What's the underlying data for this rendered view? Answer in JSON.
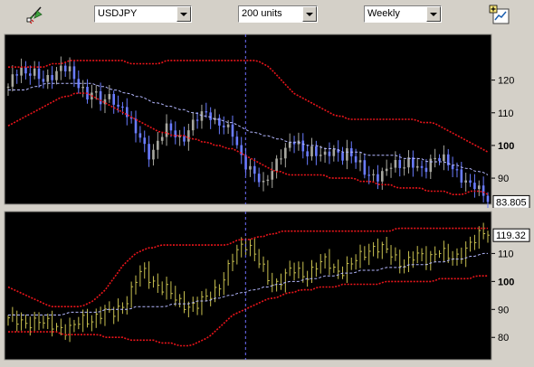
{
  "toolbar": {
    "symbol": "USDJPY",
    "units": "200 units",
    "period": "Weekly",
    "icons": [
      "drawing-tools-icon",
      "chart-settings-icon"
    ]
  },
  "colors": {
    "chart_bg": "#000000",
    "band": "#e8141a",
    "ma": "#b4b8ff",
    "candle_up": "#a8a8a0",
    "candle_down": "#6a7cff",
    "osc": "#c8c050",
    "grid_border": "#9c9a94",
    "cursor": "#7070ff"
  },
  "chart_data": [
    {
      "type": "candlestick",
      "ylim": [
        82,
        134
      ],
      "yticks": [
        90,
        100,
        110,
        120
      ],
      "last_value": "83.805",
      "price_points": [
        118,
        121,
        123,
        122,
        124,
        121,
        119,
        120,
        123,
        125,
        124,
        119,
        117,
        115,
        118,
        114,
        113,
        115,
        111,
        113,
        108,
        104,
        101,
        97,
        99,
        103,
        105,
        104,
        102,
        103,
        106,
        108,
        109,
        110,
        108,
        107,
        105,
        103,
        98,
        95,
        93,
        90,
        87,
        91,
        95,
        98,
        99,
        101,
        100,
        98,
        99,
        97,
        96,
        98,
        99,
        97,
        98,
        95,
        94,
        92,
        91,
        90,
        91,
        94,
        95,
        94,
        95,
        93,
        92,
        94,
        97,
        96,
        95,
        93,
        92,
        90,
        88,
        87,
        85,
        84
      ],
      "band_upper": [
        124,
        124,
        124,
        124,
        124,
        124,
        124,
        125,
        125,
        125,
        126,
        126,
        126,
        126,
        126,
        126,
        126,
        126,
        126,
        126,
        125,
        125,
        125,
        125,
        125,
        125,
        126,
        126,
        126,
        126,
        126,
        126,
        126,
        126,
        126,
        126,
        126,
        126,
        126,
        126,
        126,
        126,
        125,
        124,
        122,
        120,
        118,
        116,
        115,
        114,
        113,
        112,
        111,
        110,
        109,
        109,
        108,
        108,
        108,
        108,
        108,
        108,
        108,
        108,
        108,
        108,
        108,
        108,
        107,
        107,
        107,
        106,
        105,
        104,
        103,
        102,
        101,
        100,
        99,
        98
      ],
      "band_lower": [
        106,
        107,
        108,
        109,
        110,
        111,
        112,
        113,
        114,
        115,
        115,
        116,
        116,
        116,
        115,
        114,
        113,
        112,
        111,
        110,
        109,
        108,
        107,
        106,
        105,
        104,
        104,
        103,
        103,
        103,
        102,
        102,
        101,
        101,
        100,
        100,
        99,
        99,
        98,
        97,
        96,
        95,
        94,
        93,
        92,
        92,
        91,
        91,
        91,
        91,
        91,
        91,
        91,
        90,
        90,
        90,
        90,
        90,
        89,
        89,
        89,
        88,
        88,
        88,
        87,
        87,
        87,
        87,
        87,
        86,
        86,
        86,
        86,
        85,
        85,
        85,
        86,
        86,
        86,
        85
      ],
      "ma_line": [
        117,
        117,
        117,
        117,
        118,
        118,
        119,
        119,
        119,
        119,
        119,
        119,
        119,
        119,
        119,
        118,
        118,
        117,
        117,
        116,
        116,
        115,
        115,
        114,
        113,
        113,
        112,
        112,
        111,
        111,
        110,
        110,
        109,
        109,
        108,
        108,
        107,
        107,
        106,
        105,
        104,
        104,
        103,
        103,
        102,
        102,
        101,
        101,
        101,
        100,
        100,
        100,
        99,
        99,
        99,
        98,
        98,
        98,
        98,
        97,
        97,
        97,
        97,
        97,
        97,
        96,
        96,
        96,
        96,
        95,
        95,
        95,
        95,
        94,
        94,
        93,
        93,
        92,
        92,
        91
      ]
    },
    {
      "type": "bar",
      "ylim": [
        72,
        125
      ],
      "yticks": [
        80,
        90,
        100,
        110
      ],
      "last_value": "119.32",
      "osc_points": [
        87,
        86,
        85,
        85,
        86,
        86,
        85,
        84,
        84,
        83,
        83,
        84,
        86,
        86,
        87,
        88,
        89,
        88,
        90,
        92,
        95,
        100,
        104,
        102,
        100,
        98,
        97,
        95,
        93,
        92,
        91,
        91,
        93,
        95,
        97,
        99,
        103,
        108,
        112,
        114,
        112,
        108,
        104,
        100,
        99,
        101,
        103,
        104,
        103,
        102,
        104,
        106,
        107,
        106,
        104,
        104,
        105,
        107,
        109,
        111,
        112,
        112,
        111,
        110,
        108,
        106,
        107,
        109,
        109,
        108,
        110,
        111,
        109,
        108,
        109,
        111,
        113,
        115,
        117,
        118
      ],
      "band_upper": [
        98,
        97,
        96,
        95,
        94,
        93,
        92,
        91,
        91,
        91,
        91,
        91,
        91,
        92,
        93,
        95,
        97,
        100,
        103,
        106,
        108,
        110,
        111,
        112,
        112,
        113,
        113,
        113,
        113,
        113,
        113,
        113,
        113,
        113,
        113,
        113,
        113,
        114,
        115,
        115,
        115,
        116,
        116,
        117,
        117,
        118,
        118,
        118,
        118,
        118,
        118,
        118,
        118,
        118,
        118,
        118,
        118,
        118,
        118,
        118,
        118,
        118,
        118,
        118,
        119,
        119,
        119,
        119,
        119,
        119,
        119,
        119,
        119,
        119,
        119,
        119,
        119,
        119,
        119,
        119
      ],
      "band_lower": [
        82,
        82,
        82,
        82,
        82,
        82,
        82,
        82,
        82,
        81,
        81,
        81,
        81,
        81,
        81,
        81,
        80,
        80,
        80,
        80,
        79,
        79,
        79,
        79,
        79,
        78,
        78,
        78,
        77,
        77,
        77,
        78,
        79,
        80,
        82,
        84,
        86,
        88,
        89,
        90,
        91,
        92,
        93,
        94,
        94,
        95,
        96,
        96,
        97,
        97,
        97,
        98,
        98,
        98,
        98,
        99,
        99,
        99,
        99,
        99,
        99,
        99,
        100,
        100,
        100,
        100,
        100,
        100,
        100,
        100,
        100,
        101,
        101,
        101,
        101,
        101,
        101,
        102,
        102,
        102
      ],
      "ma_line": [
        88,
        88,
        88,
        88,
        88,
        88,
        88,
        88,
        88,
        88,
        89,
        89,
        89,
        89,
        89,
        89,
        90,
        90,
        90,
        90,
        90,
        91,
        91,
        91,
        91,
        91,
        91,
        92,
        92,
        92,
        92,
        93,
        93,
        93,
        94,
        94,
        95,
        95,
        96,
        96,
        97,
        97,
        98,
        98,
        99,
        99,
        100,
        100,
        100,
        101,
        101,
        101,
        102,
        102,
        102,
        103,
        103,
        103,
        104,
        104,
        104,
        104,
        105,
        105,
        105,
        105,
        106,
        106,
        106,
        106,
        107,
        107,
        107,
        108,
        108,
        108,
        109,
        109,
        110,
        110
      ]
    }
  ]
}
